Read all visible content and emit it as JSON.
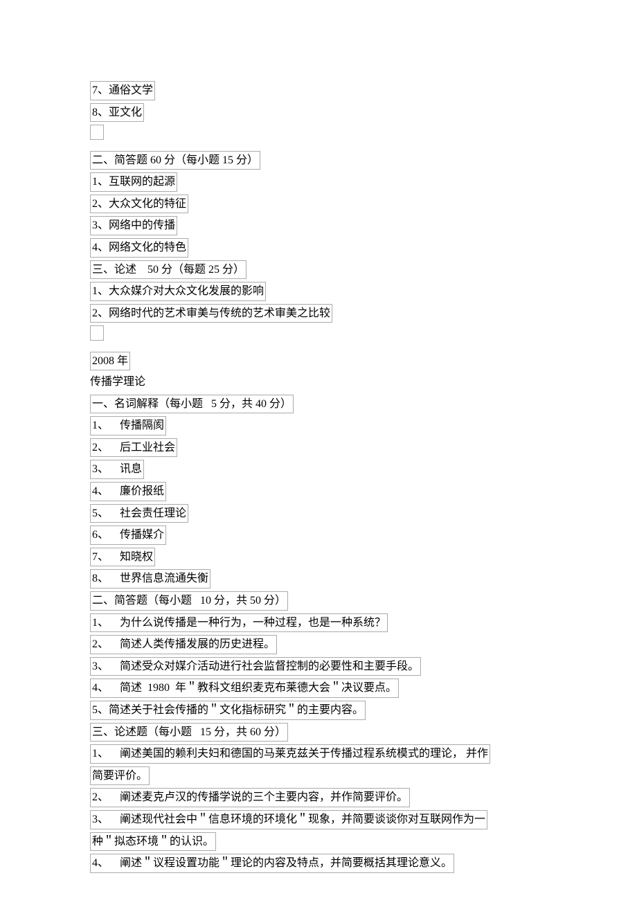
{
  "lines": [
    {
      "type": "box",
      "text": "7、通俗文学"
    },
    {
      "type": "box",
      "text": "8、亚文化"
    },
    {
      "type": "empty",
      "text": ""
    },
    {
      "type": "box",
      "text": "二、简答题 60 分（每小题 15 分）"
    },
    {
      "type": "box",
      "text": "1、互联网的起源"
    },
    {
      "type": "box",
      "text": "2、大众文化的特征"
    },
    {
      "type": "box",
      "text": "3、网络中的传播"
    },
    {
      "type": "box",
      "text": "4、网络文化的特色"
    },
    {
      "type": "box",
      "text": "三、论述    50 分（每题 25 分）"
    },
    {
      "type": "box",
      "text": "1、大众媒介对大众文化发展的影响"
    },
    {
      "type": "box",
      "text": "2、网络时代的艺术审美与传统的艺术审美之比较"
    },
    {
      "type": "empty",
      "text": ""
    },
    {
      "type": "box",
      "text": "2008 年"
    },
    {
      "type": "plain",
      "text": "传播学理论"
    },
    {
      "type": "box",
      "text": "一、名词解释（每小题   5 分，共 40 分）"
    },
    {
      "type": "box",
      "text": "1、    传播隔阂"
    },
    {
      "type": "box",
      "text": "2、    后工业社会"
    },
    {
      "type": "box",
      "text": "3、    讯息"
    },
    {
      "type": "box",
      "text": "4、    廉价报纸"
    },
    {
      "type": "box",
      "text": "5、    社会责任理论"
    },
    {
      "type": "box",
      "text": "6、    传播媒介"
    },
    {
      "type": "box",
      "text": "7、    知晓权"
    },
    {
      "type": "box",
      "text": "8、    世界信息流通失衡"
    },
    {
      "type": "box",
      "text": "二、简答题（每小题   10 分，共 50 分）"
    },
    {
      "type": "box",
      "text": "1、    为什么说传播是一种行为，一种过程，也是一种系统？"
    },
    {
      "type": "box",
      "text": "2、    简述人类传播发展的历史进程。"
    },
    {
      "type": "box",
      "text": "3、    简述受众对媒介活动进行社会监督控制的必要性和主要手段。"
    },
    {
      "type": "box",
      "text": "4、    简述  1980  年＂教科文组织麦克布莱德大会＂决议要点。"
    },
    {
      "type": "box",
      "text": "5、简述关于社会传播的＂文化指标研究＂的主要内容。"
    },
    {
      "type": "box",
      "text": "三、论述题（每小题   15 分，共 60 分）"
    },
    {
      "type": "box-wrap",
      "parts": [
        "1、    阐述美国的赖利夫妇和德国的马莱克兹关于传播过程系统模式的理论， 并作",
        "简要评价。"
      ]
    },
    {
      "type": "box",
      "text": "2、    阐述麦克卢汉的传播学说的三个主要内容，并作简要评价。"
    },
    {
      "type": "box-wrap",
      "parts": [
        "3、    阐述现代社会中＂信息环境的环境化＂现象，并简要谈谈你对互联网作为一",
        "种＂拟态环境＂的认识。"
      ]
    },
    {
      "type": "box",
      "text": "4、    阐述＂议程设置功能＂理论的内容及特点，并简要概括其理论意义。"
    }
  ]
}
